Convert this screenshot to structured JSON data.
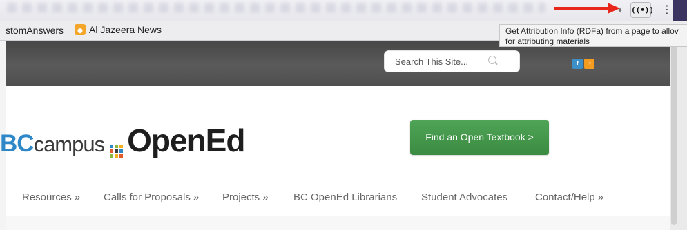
{
  "browser": {
    "bookmarks": [
      {
        "label": "stomAnswers"
      },
      {
        "label": "Al Jazeera News",
        "icon": "al-jazeera-logo"
      }
    ],
    "extension_icon_label": "((•))",
    "menu_icon": "⋮",
    "tooltip": {
      "line1": "Get Attribution Info (RDFa) from a page to allov",
      "line2": "for attributing materials"
    },
    "annotation_arrow_color": "#e8261c"
  },
  "site": {
    "search_placeholder": "Search This Site...",
    "social": [
      {
        "name": "twitter-icon",
        "glyph": "t"
      },
      {
        "name": "rss-icon",
        "glyph": "⑂"
      }
    ],
    "logo": {
      "part1": "BC",
      "part2": "campus",
      "part3": "OpenEd",
      "dot_colors": [
        "#2e88c8",
        "#8ab93f",
        "#f2b11d",
        "#e15b2a",
        "#3a3a3a",
        "#2e88c8",
        "#8ab93f",
        "#f2b11d",
        "#e15b2a"
      ]
    },
    "cta_label": "Find an Open Textbook >",
    "nav": [
      "Resources »",
      "Calls for Proposals »",
      "Projects »",
      "BC OpenEd Librarians",
      "Student Advocates",
      "Contact/Help »"
    ],
    "colors": {
      "header_bg": "#4f4f4f",
      "cta_green": "#45994c",
      "brand_blue": "#2e88c8"
    }
  }
}
